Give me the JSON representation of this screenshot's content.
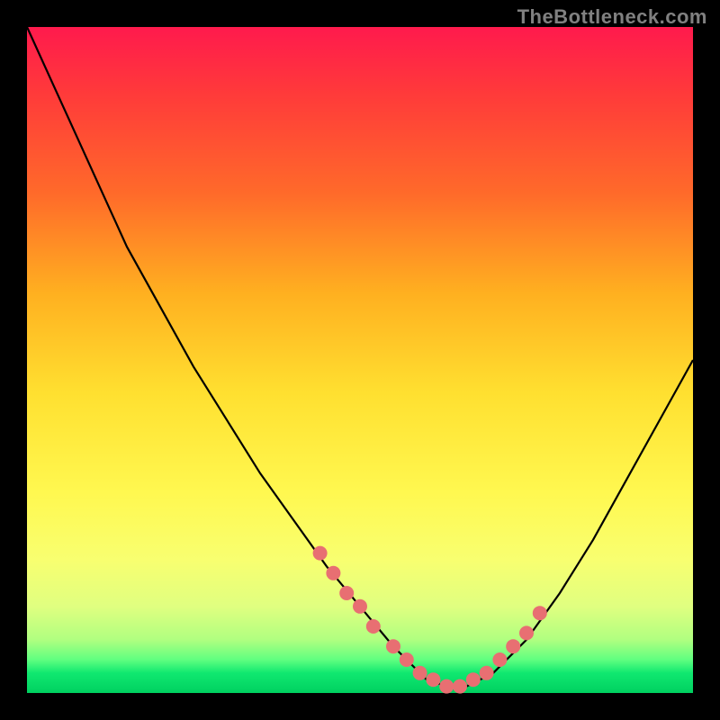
{
  "watermark": "TheBottleneck.com",
  "colors": {
    "background": "#000000",
    "curve": "#000000",
    "marker": "#e86f72",
    "gradient_top": "#ff1a4d",
    "gradient_bottom": "#00d060"
  },
  "chart_data": {
    "type": "line",
    "title": "",
    "xlabel": "",
    "ylabel": "",
    "xlim": [
      0,
      100
    ],
    "ylim": [
      0,
      100
    ],
    "note": "No axis ticks or numeric labels are rendered; x/y are normalized 0–100 to the plot area. y represents bottleneck percentage (0 = optimal, 100 = worst), rendered against a red→green vertical gradient.",
    "series": [
      {
        "name": "bottleneck-curve",
        "x": [
          0,
          5,
          10,
          15,
          20,
          25,
          30,
          35,
          40,
          45,
          50,
          55,
          58,
          60,
          63,
          66,
          70,
          75,
          80,
          85,
          90,
          95,
          100
        ],
        "y": [
          100,
          89,
          78,
          67,
          58,
          49,
          41,
          33,
          26,
          19,
          13,
          7,
          4,
          2,
          1,
          1,
          3,
          8,
          15,
          23,
          32,
          41,
          50
        ]
      }
    ],
    "markers": {
      "name": "highlight-points",
      "x": [
        44,
        46,
        48,
        50,
        52,
        55,
        57,
        59,
        61,
        63,
        65,
        67,
        69,
        71,
        73,
        75,
        77
      ],
      "y": [
        21,
        18,
        15,
        13,
        10,
        7,
        5,
        3,
        2,
        1,
        1,
        2,
        3,
        5,
        7,
        9,
        12
      ]
    }
  }
}
